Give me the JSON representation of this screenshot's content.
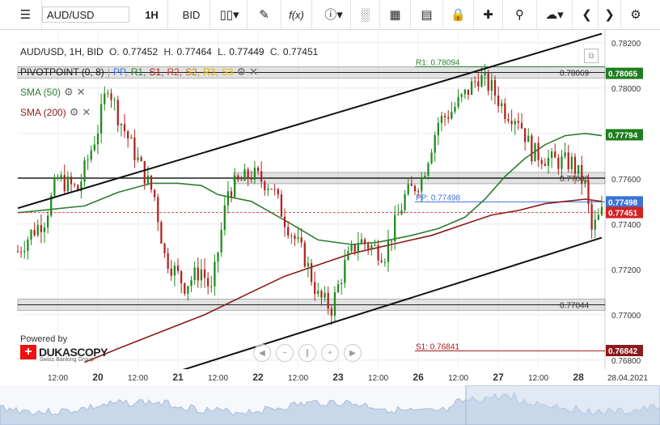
{
  "toolbar": {
    "symbol": "AUD/USD",
    "timeframe": "1H",
    "price_side": "BID",
    "icons": [
      "menu-icon",
      "candles-icon",
      "draw-icon",
      "function-icon",
      "info-icon",
      "bars-icon",
      "calendar-icon",
      "lock-icon",
      "crosshair-icon",
      "zoom-icon",
      "upload-icon",
      "prev-icon",
      "next-icon",
      "settings-icon"
    ],
    "function_label": "f(x)"
  },
  "header": {
    "title": "AUD/USD, 1H, BID",
    "open_label": "O.",
    "open": "0.77452",
    "high_label": "H.",
    "high": "0.77464",
    "low_label": "L.",
    "low": "0.77449",
    "close_label": "C.",
    "close": "0.77451"
  },
  "indicators": {
    "pivot": {
      "name": "PIVOTPOINT (0, 8)",
      "pp": "PP,",
      "r1": "R1,",
      "s1": "S1,",
      "r2": "R2,",
      "s2": "S2,",
      "r3": "R3,",
      "s3": "S3"
    },
    "sma50": "SMA (50)",
    "sma200": "SMA (200)"
  },
  "colors": {
    "up": "#1e8a1e",
    "down": "#b22222",
    "pp": "#3b73d6",
    "r1": "#2e7d32",
    "s1": "#a31515",
    "r2": "#c0392b",
    "s2": "#c27b00",
    "r3": "#d4a800",
    "s3": "#e0b800",
    "sma50": "#2e7d32",
    "sma200": "#8b1a1a"
  },
  "logo": {
    "powered_by": "Powered by",
    "brand": "DUKASCOPY",
    "sub": "Swiss Banking Group"
  },
  "chart_data": {
    "type": "candlestick",
    "ylim": [
      0.7676,
      0.7826
    ],
    "yticks": [
      "0.78200",
      "0.78000",
      "0.77800",
      "0.77600",
      "0.77400",
      "0.77200",
      "0.77000",
      "0.76800"
    ],
    "ytick_values": [
      0.782,
      0.78,
      0.778,
      0.776,
      0.774,
      0.772,
      0.77,
      0.768
    ],
    "x_labels": [
      "12:00",
      "20",
      "12:00",
      "21",
      "12:00",
      "22",
      "12:00",
      "23",
      "12:00",
      "26",
      "12:00",
      "27",
      "12:00",
      "28",
      "28.04.2021"
    ],
    "x_label_pos": [
      12,
      24,
      36,
      48,
      60,
      72,
      84,
      96,
      108,
      120,
      132,
      144,
      156,
      168,
      177
    ],
    "n": 176,
    "candles": {
      "ctrl": [
        [
          0,
          0.7728
        ],
        [
          4,
          0.7736
        ],
        [
          8,
          0.7742
        ],
        [
          12,
          0.776
        ],
        [
          18,
          0.7755
        ],
        [
          24,
          0.7782
        ],
        [
          27,
          0.7802
        ],
        [
          30,
          0.7788
        ],
        [
          36,
          0.7768
        ],
        [
          41,
          0.7752
        ],
        [
          44,
          0.7726
        ],
        [
          50,
          0.7713
        ],
        [
          55,
          0.772
        ],
        [
          58,
          0.771
        ],
        [
          63,
          0.7755
        ],
        [
          70,
          0.7762
        ],
        [
          76,
          0.7757
        ],
        [
          80,
          0.7742
        ],
        [
          86,
          0.7725
        ],
        [
          90,
          0.7708
        ],
        [
          94,
          0.7703
        ],
        [
          98,
          0.7722
        ],
        [
          102,
          0.7733
        ],
        [
          106,
          0.773
        ],
        [
          110,
          0.7727
        ],
        [
          116,
          0.7752
        ],
        [
          121,
          0.776
        ],
        [
          126,
          0.7785
        ],
        [
          130,
          0.779
        ],
        [
          134,
          0.7797
        ],
        [
          138,
          0.7805
        ],
        [
          142,
          0.78
        ],
        [
          146,
          0.779
        ],
        [
          150,
          0.7787
        ],
        [
          154,
          0.7772
        ],
        [
          160,
          0.7768
        ],
        [
          166,
          0.7767
        ],
        [
          170,
          0.7757
        ],
        [
          172,
          0.7737
        ],
        [
          175,
          0.7745
        ]
      ]
    },
    "trendlines": [
      {
        "name": "upper-channel",
        "p1": [
          0,
          0.7747
        ],
        "p2": [
          175,
          0.7824
        ]
      },
      {
        "name": "lower-channel",
        "p1": [
          48,
          0.7675
        ],
        "p2": [
          175,
          0.7734
        ]
      }
    ],
    "support_lines": [
      {
        "label": "0.78069",
        "value": 0.78069
      },
      {
        "label": "0.77603",
        "value": 0.77603
      },
      {
        "label": "0.77044",
        "value": 0.77044
      }
    ],
    "pivot_labels": [
      {
        "label": "R1: 0.78094",
        "value": 0.78094
      },
      {
        "label": "PP: 0.77498",
        "value": 0.77498
      },
      {
        "label": "S1: 0.76841",
        "value": 0.76841
      }
    ],
    "price_tags": [
      {
        "label": "0.78065",
        "value": 0.78065,
        "color": "#1e7e1e"
      },
      {
        "label": "0.77794",
        "value": 0.77794,
        "color": "#1e7e1e"
      },
      {
        "label": "0.77498",
        "value": 0.77498,
        "color": "#3b73d6"
      },
      {
        "label": "0.77451",
        "value": 0.77451,
        "color": "#d22222"
      },
      {
        "label": "0.76842",
        "value": 0.76842,
        "color": "#8b1a1a"
      }
    ],
    "last_price": 0.77451,
    "sma50": [
      [
        0,
        0.7745
      ],
      [
        20,
        0.7748
      ],
      [
        30,
        0.7754
      ],
      [
        40,
        0.7758
      ],
      [
        48,
        0.7758
      ],
      [
        55,
        0.7757
      ],
      [
        60,
        0.7753
      ],
      [
        70,
        0.775
      ],
      [
        76,
        0.7745
      ],
      [
        82,
        0.774
      ],
      [
        90,
        0.7733
      ],
      [
        100,
        0.7731
      ],
      [
        108,
        0.7732
      ],
      [
        118,
        0.7735
      ],
      [
        126,
        0.7738
      ],
      [
        134,
        0.7743
      ],
      [
        140,
        0.7751
      ],
      [
        146,
        0.7761
      ],
      [
        152,
        0.7769
      ],
      [
        158,
        0.7775
      ],
      [
        164,
        0.7779
      ],
      [
        170,
        0.778
      ],
      [
        175,
        0.7779
      ]
    ],
    "sma200": [
      [
        20,
        0.7679
      ],
      [
        30,
        0.7685
      ],
      [
        42,
        0.7692
      ],
      [
        56,
        0.77
      ],
      [
        70,
        0.771
      ],
      [
        80,
        0.7717
      ],
      [
        90,
        0.7722
      ],
      [
        100,
        0.7727
      ],
      [
        112,
        0.7731
      ],
      [
        124,
        0.7735
      ],
      [
        134,
        0.774
      ],
      [
        142,
        0.7744
      ],
      [
        150,
        0.7746
      ],
      [
        158,
        0.7749
      ],
      [
        164,
        0.775
      ],
      [
        170,
        0.7751
      ],
      [
        175,
        0.775
      ]
    ]
  }
}
